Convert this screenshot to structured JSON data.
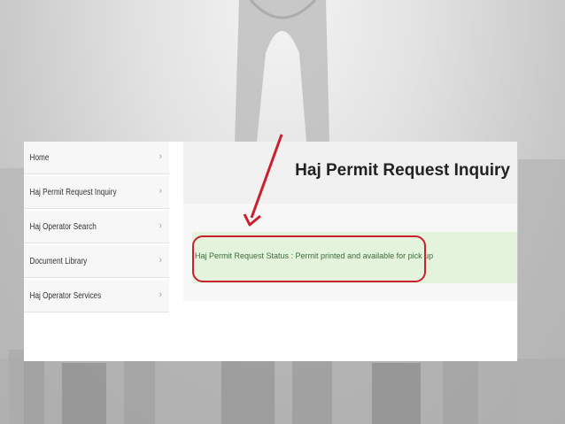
{
  "sidebar": {
    "items": [
      {
        "label": "Home"
      },
      {
        "label": "Haj Permit Request Inquiry"
      },
      {
        "label": "Haj Operator Search"
      },
      {
        "label": "Document Library"
      },
      {
        "label": "Haj Operator Services"
      }
    ],
    "chevron": "›"
  },
  "main": {
    "title": "Haj Permit Request Inquiry",
    "status_text": "Haj Permit Request Status : Permit printed and available for pick up"
  },
  "colors": {
    "highlight": "#c8202c",
    "status_background": "#e4f3dc"
  },
  "icons": {
    "chevron": "chevron-right-icon"
  }
}
